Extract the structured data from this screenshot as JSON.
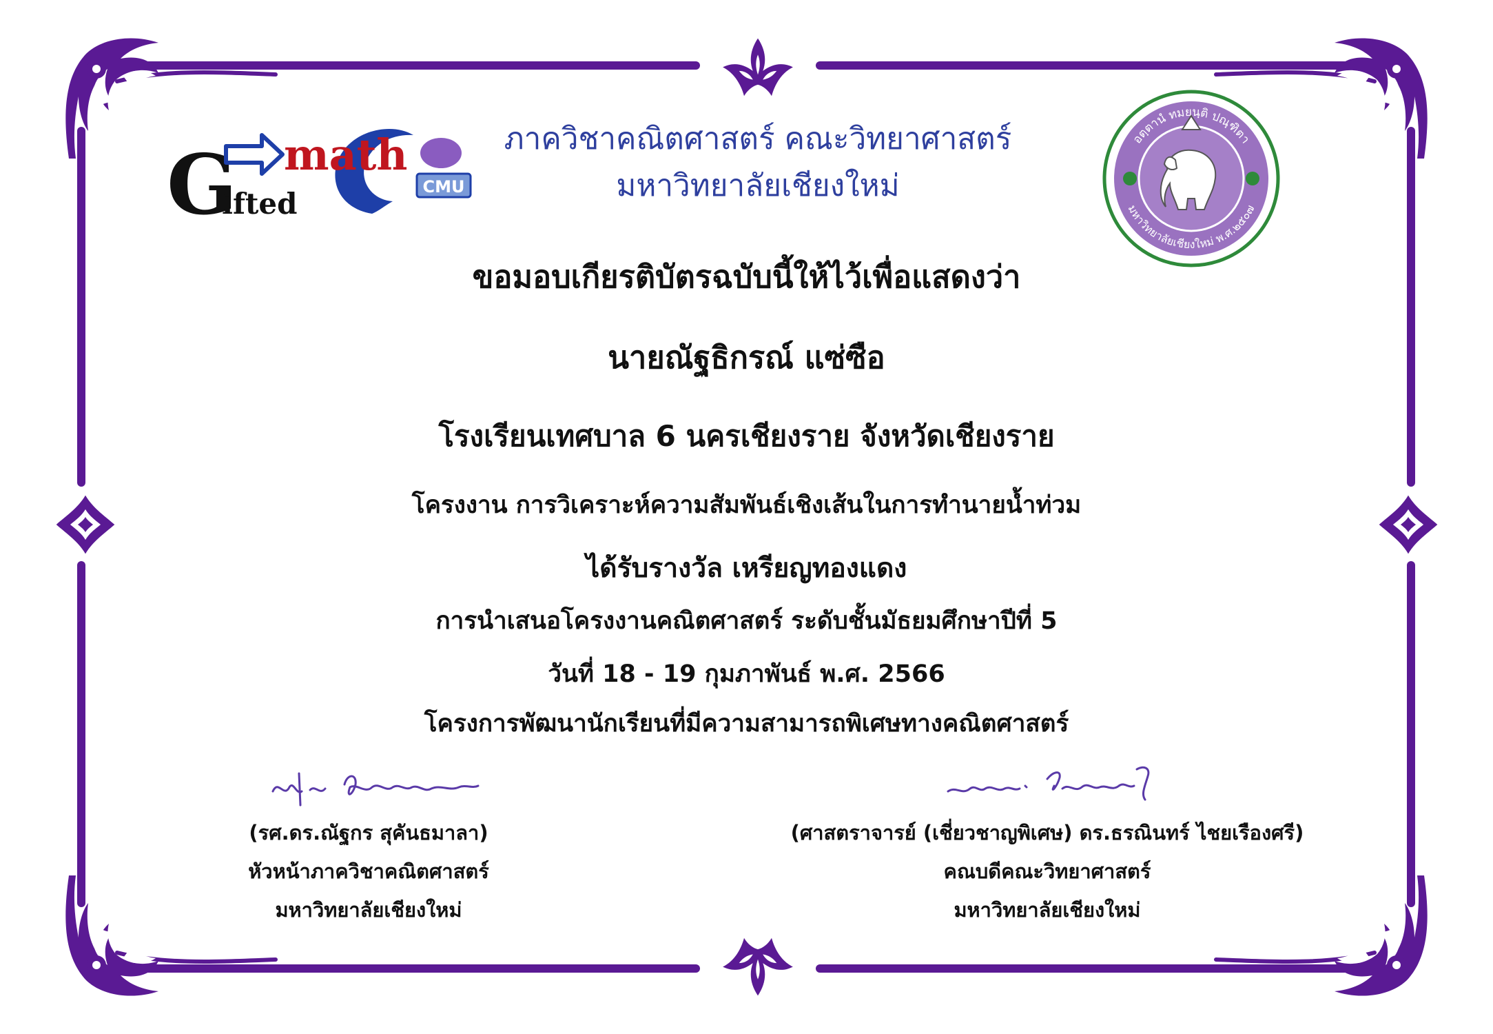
{
  "logo": {
    "g_letter": "G",
    "ifted": "ifted",
    "math": "math",
    "cmu": "CMU"
  },
  "header": {
    "department": "ภาควิชาคณิตศาสตร์ คณะวิทยาศาสตร์",
    "university": "มหาวิทยาลัยเชียงใหม่"
  },
  "seal": {
    "top_text": "อตฺตานํ ทมยนฺติ ปณฺฑิตา",
    "bottom_text": "มหาวิทยาลัยเชียงใหม่ พ.ศ.๒๕๐๗"
  },
  "certificate": {
    "intro": "ขอมอบเกียรติบัตรฉบับนี้ให้ไว้เพื่อแสดงว่า",
    "recipient": "นายณัฐธิกรณ์  แซ่ซือ",
    "school": "โรงเรียนเทศบาล 6 นครเชียงราย  จังหวัดเชียงราย",
    "project": "โครงงาน การวิเคราะห์ความสัมพันธ์เชิงเส้นในการทำนายน้ำท่วม",
    "award": "ได้รับรางวัล เหรียญทองแดง",
    "event": "การนำเสนอโครงงานคณิตศาสตร์ ระดับชั้นมัธยมศึกษาปีที่ 5",
    "date": "วันที่ 18 - 19 กุมภาพันธ์ พ.ศ. 2566",
    "program": "โครงการพัฒนานักเรียนที่มีความสามารถพิเศษทางคณิตศาสตร์"
  },
  "signers": {
    "left": {
      "name": "(รศ.ดร.ณัฐกร  สุคันธมาลา)",
      "position": "หัวหน้าภาควิชาคณิตศาสตร์",
      "org": "มหาวิทยาลัยเชียงใหม่"
    },
    "right": {
      "name": "(ศาสตราจารย์ (เชี่ยวชาญพิเศษ) ดร.ธรณินทร์  ไชยเรืองศรี)",
      "position": "คณบดีคณะวิทยาศาสตร์",
      "org": "มหาวิทยาลัยเชียงใหม่"
    }
  },
  "colors": {
    "border": "#5a1a94",
    "border_light": "#7a3cb5",
    "header_text": "#2e3f9e",
    "seal_fill": "#9a72c0",
    "seal_ring": "#2e8a3a",
    "logo_blue": "#1e3fa8",
    "logo_red": "#c0161f"
  }
}
